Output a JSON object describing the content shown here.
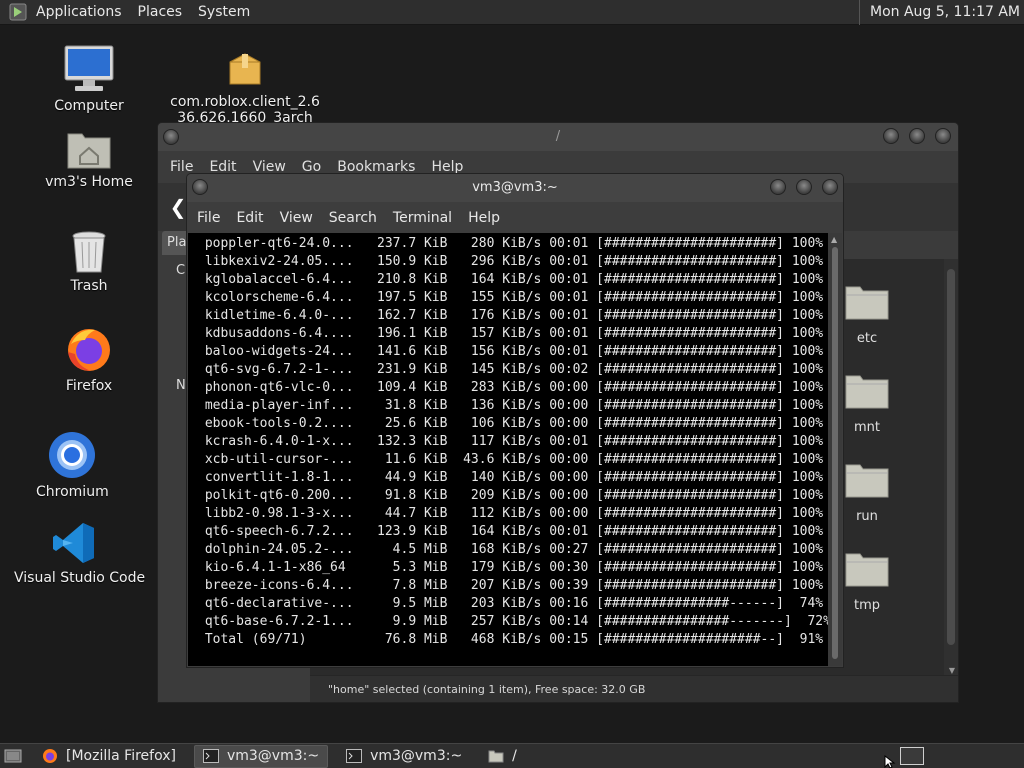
{
  "top_panel": {
    "menu": [
      "Applications",
      "Places",
      "System"
    ],
    "clock": "Mon Aug  5, 11:17 AM"
  },
  "desktop_icons": {
    "computer": "Computer",
    "package": "com.roblox.client_2.636.626.1660_3arch",
    "home": "vm3's Home",
    "trash": "Trash",
    "firefox": "Firefox",
    "chromium": "Chromium",
    "vscode": "Visual Studio Code"
  },
  "file_manager": {
    "title": "/",
    "menu": [
      "File",
      "Edit",
      "View",
      "Go",
      "Bookmarks",
      "Help"
    ],
    "sidebar_tab": "Pla",
    "sidebar_c": "C",
    "sidebar_n": "N",
    "folders": [
      "etc",
      "mnt",
      "run",
      "tmp"
    ],
    "status": "\"home\" selected (containing 1 item), Free space: 32.0 GB"
  },
  "terminal": {
    "title": "vm3@vm3:~",
    "menu": [
      "File",
      "Edit",
      "View",
      "Search",
      "Terminal",
      "Help"
    ],
    "lines": [
      " poppler-qt6-24.0...   237.7 KiB   280 KiB/s 00:01 [######################] 100%",
      " libkexiv2-24.05....   150.9 KiB   296 KiB/s 00:01 [######################] 100%",
      " kglobalaccel-6.4...   210.8 KiB   164 KiB/s 00:01 [######################] 100%",
      " kcolorscheme-6.4...   197.5 KiB   155 KiB/s 00:01 [######################] 100%",
      " kidletime-6.4.0-...   162.7 KiB   176 KiB/s 00:01 [######################] 100%",
      " kdbusaddons-6.4....   196.1 KiB   157 KiB/s 00:01 [######################] 100%",
      " baloo-widgets-24...   141.6 KiB   156 KiB/s 00:01 [######################] 100%",
      " qt6-svg-6.7.2-1-...   231.9 KiB   145 KiB/s 00:02 [######################] 100%",
      " phonon-qt6-vlc-0...   109.4 KiB   283 KiB/s 00:00 [######################] 100%",
      " media-player-inf...    31.8 KiB   136 KiB/s 00:00 [######################] 100%",
      " ebook-tools-0.2....    25.6 KiB   106 KiB/s 00:00 [######################] 100%",
      " kcrash-6.4.0-1-x...   132.3 KiB   117 KiB/s 00:01 [######################] 100%",
      " xcb-util-cursor-...    11.6 KiB  43.6 KiB/s 00:00 [######################] 100%",
      " convertlit-1.8-1...    44.9 KiB   140 KiB/s 00:00 [######################] 100%",
      " polkit-qt6-0.200...    91.8 KiB   209 KiB/s 00:00 [######################] 100%",
      " libb2-0.98.1-3-x...    44.7 KiB   112 KiB/s 00:00 [######################] 100%",
      " qt6-speech-6.7.2...   123.9 KiB   164 KiB/s 00:01 [######################] 100%",
      " dolphin-24.05.2-...     4.5 MiB   168 KiB/s 00:27 [######################] 100%",
      " kio-6.4.1-1-x86_64      5.3 MiB   179 KiB/s 00:30 [######################] 100%",
      " breeze-icons-6.4...     7.8 MiB   207 KiB/s 00:39 [######################] 100%",
      " qt6-declarative-...     9.5 MiB   203 KiB/s 00:16 [################------]  74%",
      " qt6-base-6.7.2-1...     9.9 MiB   257 KiB/s 00:14 [################-------]  72%",
      " Total (69/71)          76.8 MiB   468 KiB/s 00:15 [####################--]  91%"
    ]
  },
  "taskbar": {
    "tasks": [
      "[Mozilla Firefox]",
      "vm3@vm3:~",
      "vm3@vm3:~",
      "/"
    ]
  }
}
